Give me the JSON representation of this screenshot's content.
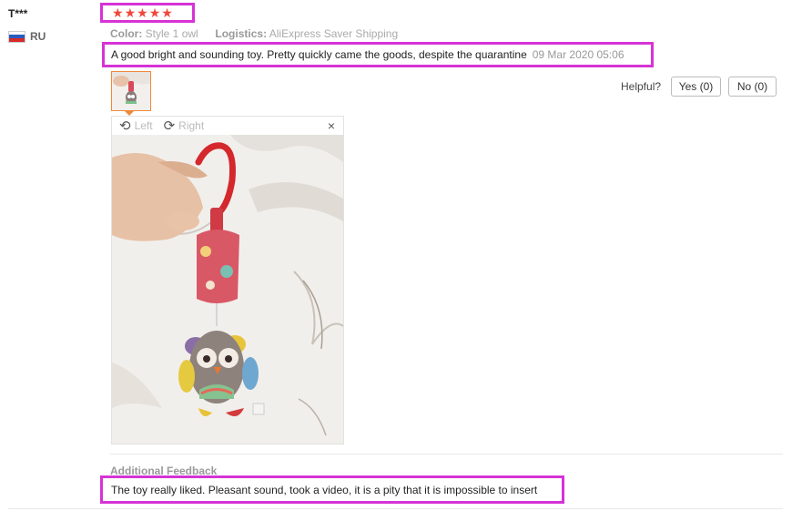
{
  "user": {
    "name": "T***",
    "country": "RU",
    "flag_colors": [
      "#ffffff",
      "#2a5bbf",
      "#d62b2b"
    ]
  },
  "rating": {
    "stars": 5,
    "glyph": "★",
    "color": "#f0473a"
  },
  "meta": {
    "color_label": "Color:",
    "color_value": "Style 1 owl",
    "logistics_label": "Logistics:",
    "logistics_value": "AliExpress Saver Shipping"
  },
  "review": {
    "text": "A good bright and sounding toy. Pretty quickly came the goods, despite the quarantine",
    "date": "09 Mar 2020 05:06"
  },
  "helpful": {
    "label": "Helpful?",
    "yes_label": "Yes (0)",
    "no_label": "No (0)"
  },
  "viewer": {
    "left_label": "Left",
    "right_label": "Right",
    "close_glyph": "×",
    "left_icon": "rotate-left-icon",
    "right_icon": "rotate-right-icon"
  },
  "additional": {
    "heading": "Additional Feedback",
    "text": "The toy really liked. Pleasant sound, took a video, it is a pity that it is impossible to insert"
  },
  "highlight_color": "#d633d6"
}
